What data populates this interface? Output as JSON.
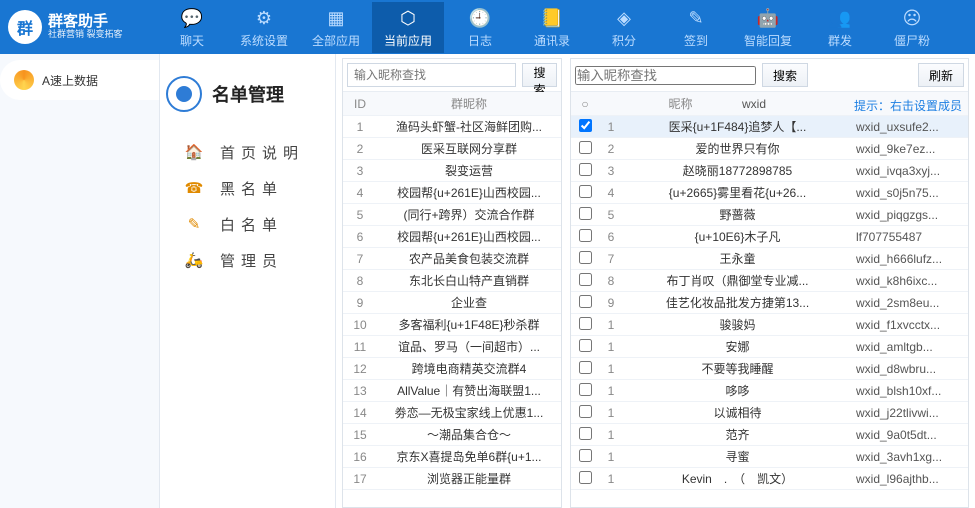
{
  "brand": {
    "badge": "群",
    "title": "群客助手",
    "sub": "社群营销 裂变拓客"
  },
  "nav": [
    {
      "icon": "💬",
      "label": "聊天"
    },
    {
      "icon": "⚙",
      "label": "系统设置"
    },
    {
      "icon": "▦",
      "label": "全部应用"
    },
    {
      "icon": "⬡",
      "label": "当前应用",
      "active": true
    },
    {
      "icon": "🕘",
      "label": "日志"
    },
    {
      "icon": "📒",
      "label": "通讯录"
    },
    {
      "icon": "◈",
      "label": "积分"
    },
    {
      "icon": "✎",
      "label": "签到"
    },
    {
      "icon": "🤖",
      "label": "智能回复"
    },
    {
      "icon": "👥",
      "label": "群发"
    },
    {
      "icon": "☹",
      "label": "僵尸粉"
    }
  ],
  "leftSidebar": [
    {
      "label": "A速上数据"
    }
  ],
  "mid": {
    "title": "名单管理",
    "items": [
      {
        "icon": "🏠",
        "label": "首页说明"
      },
      {
        "icon": "☎",
        "label": "黑名单"
      },
      {
        "icon": "✎",
        "label": "白名单"
      },
      {
        "icon": "🛵",
        "label": "管理员"
      }
    ]
  },
  "groups": {
    "searchPlaceholder": "输入昵称查找",
    "searchBtn": "搜索",
    "headers": {
      "id": "ID",
      "name": "群昵称"
    },
    "rows": [
      {
        "id": 1,
        "name": "渔码头虾蟹-社区海鲜团购..."
      },
      {
        "id": 2,
        "name": "医采互联网分享群"
      },
      {
        "id": 3,
        "name": "裂变运营"
      },
      {
        "id": 4,
        "name": "校园帮{u+261E}山西校园..."
      },
      {
        "id": 5,
        "name": "(同行+跨界）交流合作群"
      },
      {
        "id": 6,
        "name": "校园帮{u+261E}山西校园..."
      },
      {
        "id": 7,
        "name": "农产品美食包装交流群"
      },
      {
        "id": 8,
        "name": "东北长白山特产直销群"
      },
      {
        "id": 9,
        "name": "企业查"
      },
      {
        "id": 10,
        "name": "多客福利{u+1F48E}秒杀群"
      },
      {
        "id": 11,
        "name": "谊品、罗马（一间超市）..."
      },
      {
        "id": 12,
        "name": "跨境电商精英交流群4"
      },
      {
        "id": 13,
        "name": "AllValue｜有赞出海联盟1..."
      },
      {
        "id": 14,
        "name": "劵恋—无极宝家线上优惠1..."
      },
      {
        "id": 15,
        "name": "～潮品集合仓～"
      },
      {
        "id": 16,
        "name": "京东X喜提岛免单6群{u+1..."
      },
      {
        "id": 17,
        "name": "浏览器正能量群"
      }
    ]
  },
  "members": {
    "searchPlaceholder": "输入昵称查找",
    "searchBtn": "搜索",
    "refreshBtn": "刷新",
    "hint": "提示：右击设置成员",
    "headers": {
      "chk": "○",
      "nick": "昵称",
      "wxid": "wxid"
    },
    "rows": [
      {
        "n": 1,
        "chk": true,
        "nick": "医采{u+1F484}追梦人【...",
        "wxid": "wxid_uxsufe2..."
      },
      {
        "n": 2,
        "chk": false,
        "nick": "爱的世界只有你",
        "wxid": "wxid_9ke7ez..."
      },
      {
        "n": 3,
        "chk": false,
        "nick": "赵晓丽18772898785",
        "wxid": "wxid_ivqa3xyj..."
      },
      {
        "n": 4,
        "chk": false,
        "nick": "{u+2665}雾里看花{u+26...",
        "wxid": "wxid_s0j5n75..."
      },
      {
        "n": 5,
        "chk": false,
        "nick": "野蔷薇",
        "wxid": "wxid_piqgzgs..."
      },
      {
        "n": 6,
        "chk": false,
        "nick": "{u+10E6}木子凡",
        "wxid": "lf707755487"
      },
      {
        "n": 7,
        "chk": false,
        "nick": "王永童",
        "wxid": "wxid_h666lufz..."
      },
      {
        "n": 8,
        "chk": false,
        "nick": "布丁肖叹（鼎御堂专业减...",
        "wxid": "wxid_k8h6ixc..."
      },
      {
        "n": 9,
        "chk": false,
        "nick": "佳艺化妆品批发方捷第13...",
        "wxid": "wxid_2sm8eu..."
      },
      {
        "n": 1,
        "chk": false,
        "nick": "骏骏妈",
        "wxid": "wxid_f1xvcctx..."
      },
      {
        "n": 1,
        "chk": false,
        "nick": "安娜",
        "wxid": "wxid_amltgb..."
      },
      {
        "n": 1,
        "chk": false,
        "nick": "不要等我睡醒",
        "wxid": "wxid_d8wbru..."
      },
      {
        "n": 1,
        "chk": false,
        "nick": "哆哆",
        "wxid": "wxid_blsh10xf..."
      },
      {
        "n": 1,
        "chk": false,
        "nick": "以诚相待",
        "wxid": "wxid_j22tlivwi..."
      },
      {
        "n": 1,
        "chk": false,
        "nick": "范齐",
        "wxid": "wxid_9a0t5dt..."
      },
      {
        "n": 1,
        "chk": false,
        "nick": "寻蜜",
        "wxid": "wxid_3avh1xg..."
      },
      {
        "n": 1,
        "chk": false,
        "nick": "Kevin　.　（　凯文）",
        "wxid": "wxid_l96ajthb..."
      }
    ]
  }
}
